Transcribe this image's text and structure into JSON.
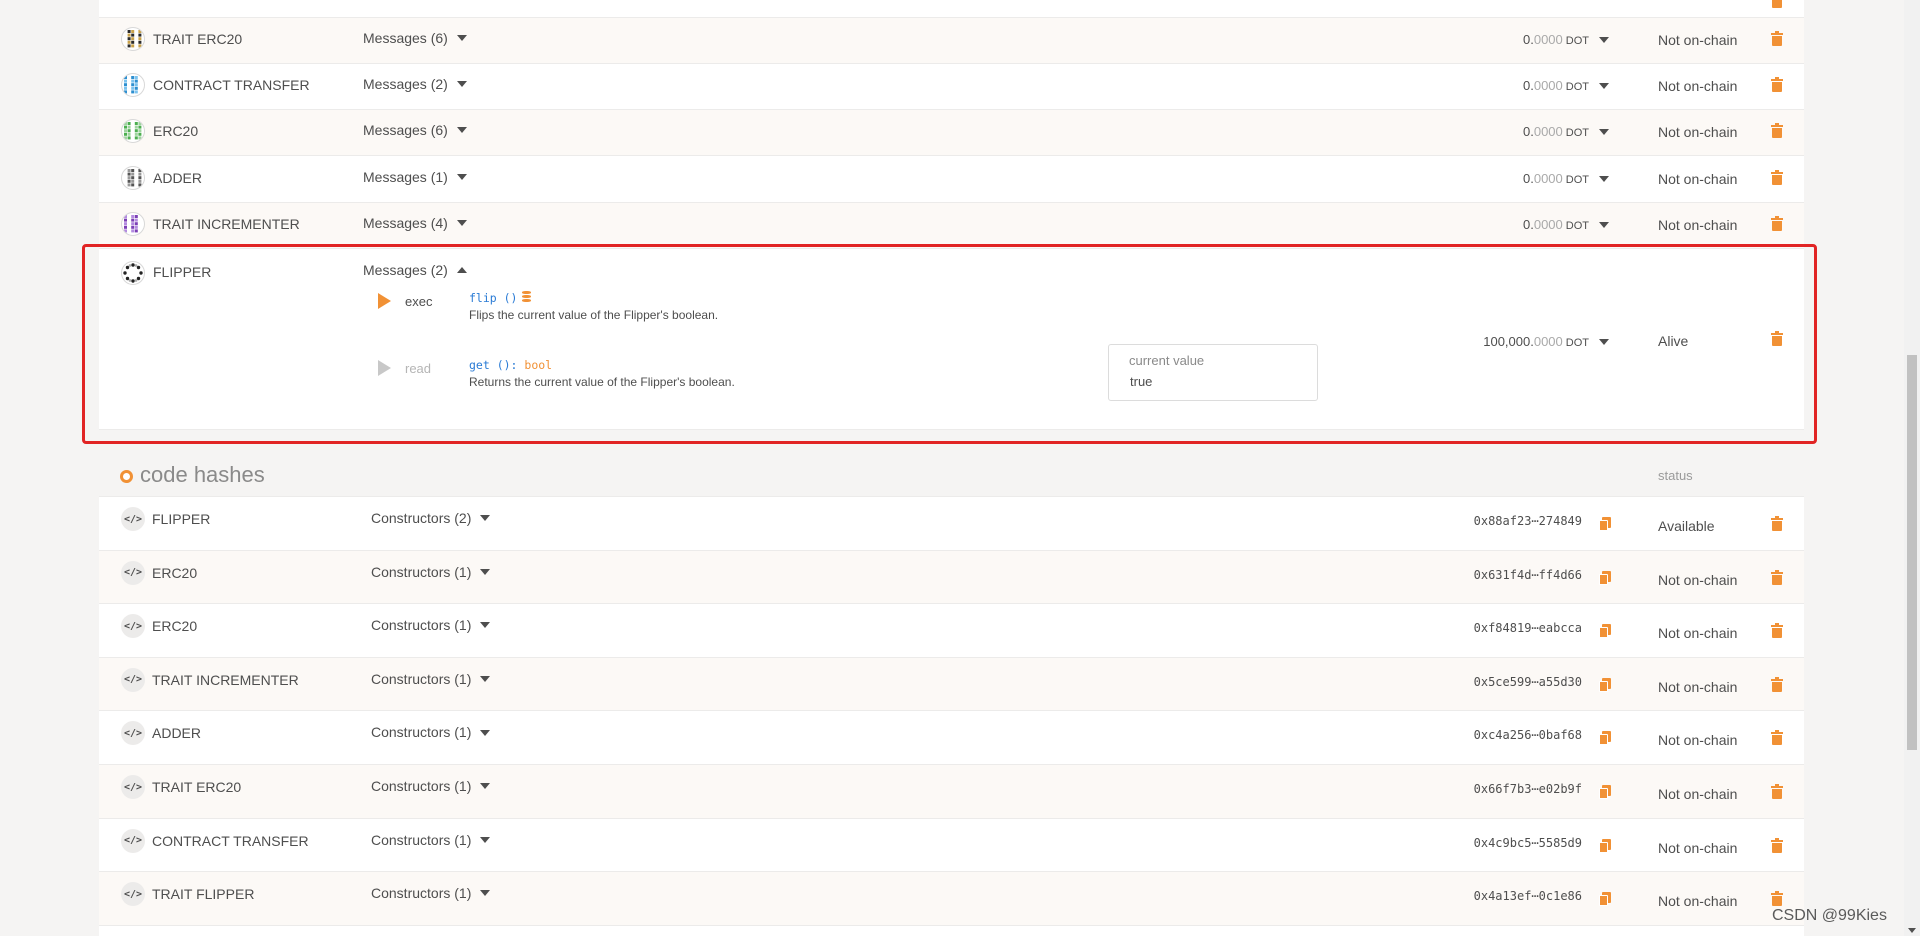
{
  "contracts": [
    {
      "name": "TRAIT ERC20",
      "messages": "Messages (6)",
      "balance_int": "0.",
      "balance_dec": "0000",
      "unit": "DOT",
      "status": "Not on-chain",
      "icon": "identicon"
    },
    {
      "name": "CONTRACT TRANSFER",
      "messages": "Messages (2)",
      "balance_int": "0.",
      "balance_dec": "0000",
      "unit": "DOT",
      "status": "Not on-chain",
      "icon": "identicon"
    },
    {
      "name": "ERC20",
      "messages": "Messages (6)",
      "balance_int": "0.",
      "balance_dec": "0000",
      "unit": "DOT",
      "status": "Not on-chain",
      "icon": "identicon"
    },
    {
      "name": "ADDER",
      "messages": "Messages (1)",
      "balance_int": "0.",
      "balance_dec": "0000",
      "unit": "DOT",
      "status": "Not on-chain",
      "icon": "identicon"
    },
    {
      "name": "TRAIT INCREMENTER",
      "messages": "Messages (4)",
      "balance_int": "0.",
      "balance_dec": "0000",
      "unit": "DOT",
      "status": "Not on-chain",
      "icon": "identicon"
    }
  ],
  "flipper": {
    "name": "FLIPPER",
    "messages": "Messages (2)",
    "balance_int": "100,000.",
    "balance_dec": "0000",
    "unit": "DOT",
    "status": "Alive",
    "exec": {
      "label": "exec",
      "fn": "flip",
      "sig": " ()",
      "desc": "Flips the current value of the Flipper's boolean."
    },
    "read": {
      "label": "read",
      "fn": "get",
      "sig": " (): ",
      "ret": "bool",
      "desc": "Returns the current value of the Flipper's boolean."
    },
    "current_value_label": "current value",
    "current_value": "true"
  },
  "code_hashes": {
    "title": "code hashes",
    "status_header": "status",
    "items": [
      {
        "name": "FLIPPER",
        "constructors": "Constructors (2)",
        "hash": "0x88af23⋯274849",
        "status": "Available"
      },
      {
        "name": "ERC20",
        "constructors": "Constructors (1)",
        "hash": "0x631f4d⋯ff4d66",
        "status": "Not on-chain"
      },
      {
        "name": "ERC20",
        "constructors": "Constructors (1)",
        "hash": "0xf84819⋯eabcca",
        "status": "Not on-chain"
      },
      {
        "name": "TRAIT INCREMENTER",
        "constructors": "Constructors (1)",
        "hash": "0x5ce599⋯a55d30",
        "status": "Not on-chain"
      },
      {
        "name": "ADDER",
        "constructors": "Constructors (1)",
        "hash": "0xc4a256⋯0baf68",
        "status": "Not on-chain"
      },
      {
        "name": "TRAIT ERC20",
        "constructors": "Constructors (1)",
        "hash": "0x66f7b3⋯e02b9f",
        "status": "Not on-chain"
      },
      {
        "name": "CONTRACT TRANSFER",
        "constructors": "Constructors (1)",
        "hash": "0x4c9bc5⋯5585d9",
        "status": "Not on-chain"
      },
      {
        "name": "TRAIT FLIPPER",
        "constructors": "Constructors (1)",
        "hash": "0x4a13ef⋯0c1e86",
        "status": "Not on-chain"
      }
    ]
  },
  "icons": {
    "code": "code-icon",
    "trash": "trash-icon",
    "copy": "copy-icon",
    "play": "play-icon",
    "database": "database-icon"
  },
  "colors": {
    "accent": "#f19135",
    "highlight": "#e12424",
    "link": "#2a7bd5"
  },
  "watermark": "CSDN @99Kies"
}
